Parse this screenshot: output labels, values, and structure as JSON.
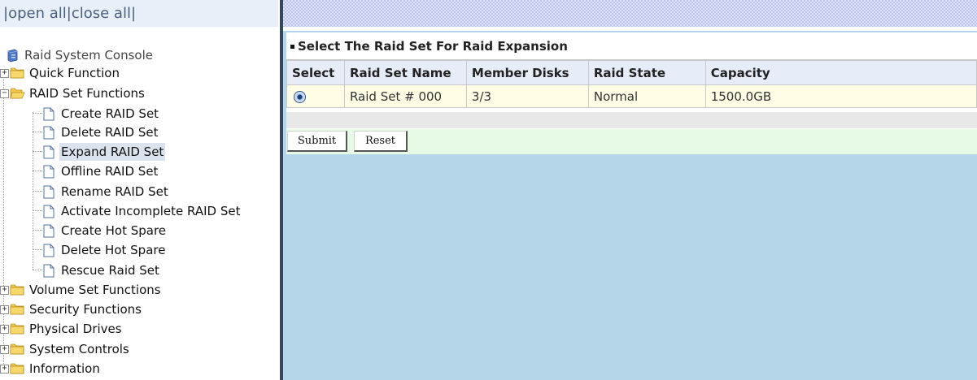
{
  "top_links": {
    "open_all": "open all",
    "close_all": "close all",
    "separator": "|"
  },
  "tree": {
    "root_label": "Raid System Console",
    "quick_function": "Quick Function",
    "raid_set_functions": {
      "label": "RAID Set Functions",
      "children": [
        "Create RAID Set",
        "Delete RAID Set",
        "Expand RAID Set",
        "Offline RAID Set",
        "Rename RAID Set",
        "Activate Incomplete RAID Set",
        "Create Hot Spare",
        "Delete Hot Spare",
        "Rescue Raid Set"
      ],
      "selected": "Expand RAID Set"
    },
    "collapsed_folders": [
      "Volume Set Functions",
      "Security Functions",
      "Physical Drives",
      "System Controls",
      "Information"
    ],
    "expander_plus": "+",
    "expander_minus": "−"
  },
  "panel": {
    "title": "Select The Raid Set For Raid Expansion",
    "columns": [
      "Select",
      "Raid Set Name",
      "Member Disks",
      "Raid State",
      "Capacity"
    ],
    "rows": [
      {
        "selected": true,
        "name": "Raid Set # 000",
        "member_disks": "3/3",
        "state": "Normal",
        "capacity": "1500.0GB"
      }
    ],
    "submit_label": "Submit",
    "reset_label": "Reset"
  },
  "colors": {
    "right_background": "#b4d6e8",
    "divider": "#35475f",
    "header_row": "#e6ecf8",
    "data_row": "#fffde6",
    "button_row": "#e6fae6",
    "top_links_bg": "#e8eff8",
    "selected_item_bg": "#dbe3ef"
  },
  "icons": {
    "root": "server-icon",
    "folder": "folder-icon",
    "folder_open": "folder-open-icon",
    "document": "document-icon",
    "expander": "tree-expander-icon",
    "radio": "radio-selected-icon"
  }
}
